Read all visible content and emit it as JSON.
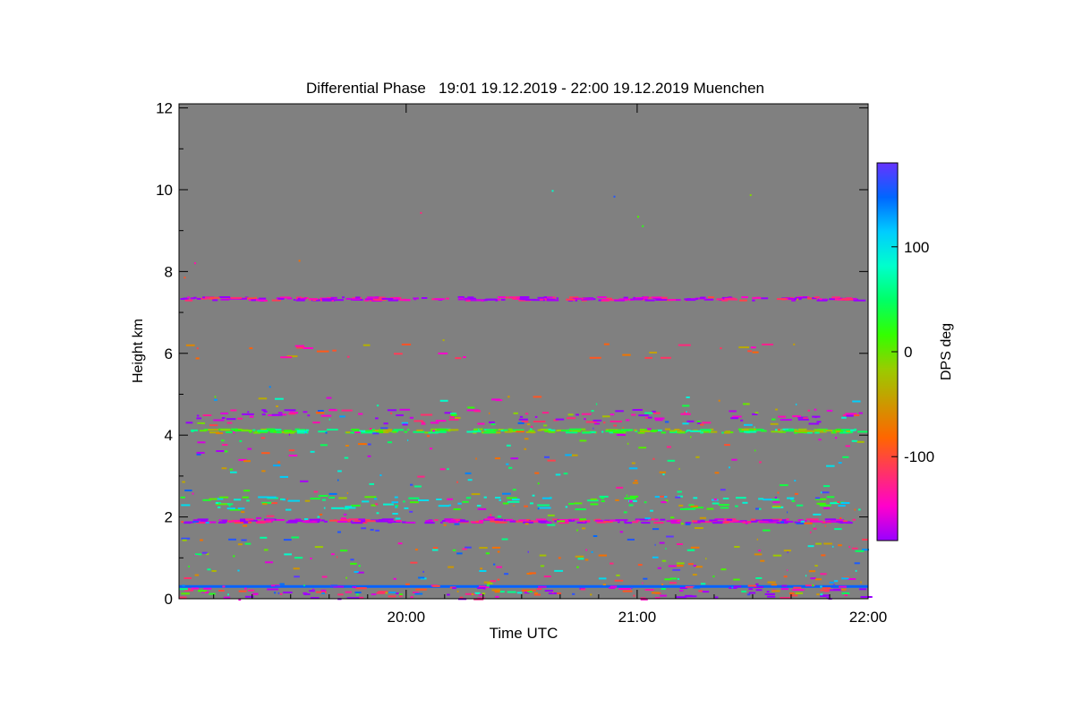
{
  "chart_data": {
    "type": "heatmap",
    "title": "Differential Phase   19:01 19.12.2019 - 22:00 19.12.2019 Muenchen",
    "xlabel": "Time UTC",
    "ylabel": "Height km",
    "x_ticks": [
      "20:00",
      "21:00",
      "22:00"
    ],
    "x_tick_minutes": [
      60,
      120,
      180
    ],
    "xlim_minutes": [
      1,
      180
    ],
    "y_ticks": [
      0,
      2,
      4,
      6,
      8,
      10,
      12
    ],
    "ylim": [
      0,
      12.1
    ],
    "background_color": "#808080",
    "colorbar": {
      "label": "DPS deg",
      "ticks": [
        100,
        0,
        -100
      ],
      "tick_labels": [
        "100",
        "0",
        "-100"
      ],
      "range": [
        -180,
        180
      ],
      "colors": [
        "#9900ff",
        "#ff00cc",
        "#ff3366",
        "#ff6600",
        "#cc9900",
        "#99cc00",
        "#33ff00",
        "#00ff66",
        "#00ffcc",
        "#00ccff",
        "#0066ff",
        "#6633ff"
      ]
    },
    "bands": [
      {
        "height_km": 0.3,
        "dps_deg": 150,
        "coverage": "continuous"
      },
      {
        "height_km": 7.33,
        "dps_deg": -160,
        "coverage": "dense"
      },
      {
        "height_km": 4.1,
        "dps_deg": 20,
        "coverage": "dense"
      },
      {
        "height_km": 1.9,
        "dps_deg": -160,
        "coverage": "dense"
      },
      {
        "height_km": 2.35,
        "dps_deg": 60,
        "coverage": "scattered"
      },
      {
        "height_km": 4.45,
        "dps_deg": -170,
        "coverage": "scattered"
      },
      {
        "height_km": 6.05,
        "dps_deg": -90,
        "coverage": "sparse"
      },
      {
        "height_km": 0.15,
        "dps_deg": -150,
        "coverage": "scattered"
      }
    ]
  }
}
